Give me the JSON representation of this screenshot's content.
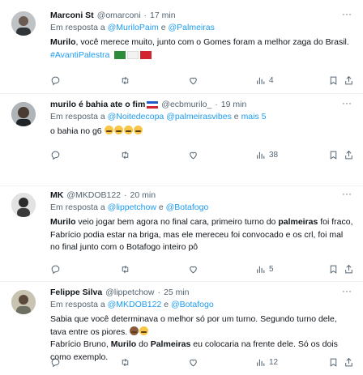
{
  "tweets": [
    {
      "name": "Marconi St",
      "handle": "@omarconi",
      "time": "17 min",
      "reply_prefix": "Em resposta a",
      "reply_m1": "@MuriloPaim",
      "reply_and": "e",
      "reply_m2": "@Palmeiras",
      "body": {
        "bold1": "Murilo",
        "text1": ", você merece muito, junto com o Gomes foram a melhor zaga do Brasil.",
        "hashtag": "#AvantiPalestra"
      },
      "actions": {
        "replies": "",
        "retweets": "",
        "likes": "",
        "views": "4"
      }
    },
    {
      "name": "murilo é bahia ate o fim",
      "handle": "@ecbmurilo_",
      "time": "19 min",
      "reply_prefix": "Em resposta a",
      "reply_m1": "@Noitedecopa",
      "reply_m2": "@palmeirasvibes",
      "reply_and": "e",
      "reply_more": "mais 5",
      "body": {
        "text1": "o bahia no g6"
      },
      "actions": {
        "replies": "",
        "retweets": "",
        "likes": "",
        "views": "38"
      }
    },
    {
      "name": "MK",
      "handle": "@MKDOB122",
      "time": "20 min",
      "reply_prefix": "Em resposta a",
      "reply_m1": "@lippetchow",
      "reply_and": "e",
      "reply_m2": "@Botafogo",
      "body": {
        "bold1": "Murilo",
        "text1": " veio jogar bem agora no final cara, primeiro turno do ",
        "bold2": "palmeiras",
        "text2": " foi fraco, Fabrício podia estar na briga, mas ele mereceu foi convocado e os crl, foi mal no final junto com o Botafogo inteiro pô"
      },
      "actions": {
        "replies": "",
        "retweets": "",
        "likes": "",
        "views": "5"
      }
    },
    {
      "name": "Felippe Silva",
      "handle": "@lippetchow",
      "time": "25 min",
      "reply_prefix": "Em resposta a",
      "reply_m1": "@MKDOB122",
      "reply_and": "e",
      "reply_m2": "@Botafogo",
      "body": {
        "line1": "Sabia que você determinava o melhor só por um turno. Segundo turno dele, tava entre os piores.",
        "line2a": "Fabrício Bruno, ",
        "bold1": "Murilo",
        "line2b": " do ",
        "bold2": "Palmeiras",
        "line2c": " eu colocaria na frente dele. Só os dois como exemplo."
      },
      "actions": {
        "replies": "",
        "retweets": "",
        "likes": "",
        "views": "12"
      }
    }
  ],
  "separators": {
    "dot": "·"
  },
  "icons": [
    "more-icon",
    "reply-icon",
    "retweet-icon",
    "like-icon",
    "views-icon",
    "bookmark-icon",
    "share-icon"
  ],
  "colors": {
    "link": "#1d9bf0",
    "muted": "#536471",
    "text": "#0f1419",
    "divider": "#eff3f4"
  }
}
